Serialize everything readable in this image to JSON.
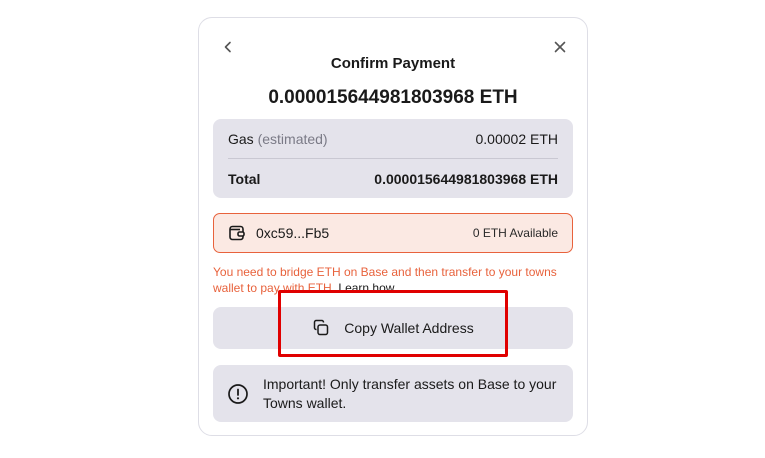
{
  "header": {
    "back_icon": "chevron-left-icon",
    "close_icon": "close-icon",
    "title": "Confirm Payment"
  },
  "amount": "0.000015644981803968 ETH",
  "summary": {
    "gas_label": "Gas",
    "gas_qualifier": "(estimated)",
    "gas_value": "0.00002 ETH",
    "total_label": "Total",
    "total_value": "0.000015644981803968 ETH"
  },
  "wallet": {
    "icon": "wallet-icon",
    "address": "0xc59...Fb5",
    "available": "0 ETH Available",
    "border_color": "#e8623c"
  },
  "warning": {
    "text": "You need to bridge ETH on Base and then transfer to your towns wallet to pay with ETH.",
    "learn_link": "Learn how"
  },
  "copy_button": {
    "icon": "copy-icon",
    "label": "Copy Wallet Address"
  },
  "notice": {
    "icon": "info-circle-icon",
    "text": "Important! Only transfer assets on Base to your Towns wallet."
  },
  "colors": {
    "accent_warning": "#e8623c",
    "panel_bg": "#e4e3eb",
    "highlight": "#e00000"
  }
}
